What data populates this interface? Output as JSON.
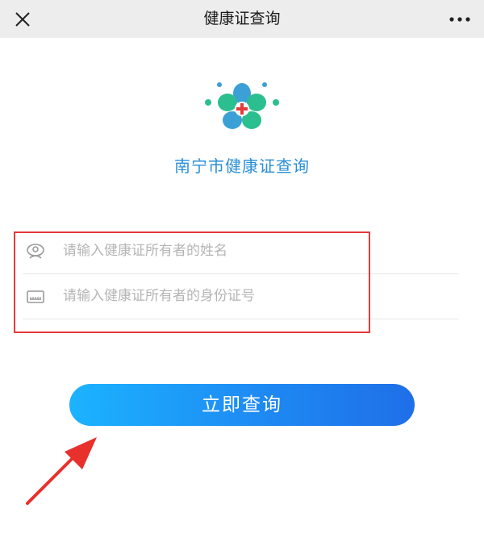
{
  "navbar": {
    "title": "健康证查询",
    "close_icon": "close-icon",
    "more_icon": "more-icon"
  },
  "header": {
    "logo_icon": "flower-cross-logo",
    "app_name": "南宁市健康证查询"
  },
  "form": {
    "name_field": {
      "icon": "person-icon",
      "placeholder": "请输入健康证所有者的姓名",
      "value": ""
    },
    "id_field": {
      "icon": "id-card-icon",
      "placeholder": "请输入健康证所有者的身份证号",
      "value": ""
    },
    "highlight_color": "#e53a3a"
  },
  "submit": {
    "label": "立即查询"
  },
  "annotation": {
    "arrow_color": "#e8302c"
  },
  "colors": {
    "accent": "#2a8fd6",
    "button_start": "#1cb3ff",
    "button_end": "#1f6fe8",
    "logo_primary": "#2bbf8f",
    "logo_cross": "#e53a3a"
  }
}
